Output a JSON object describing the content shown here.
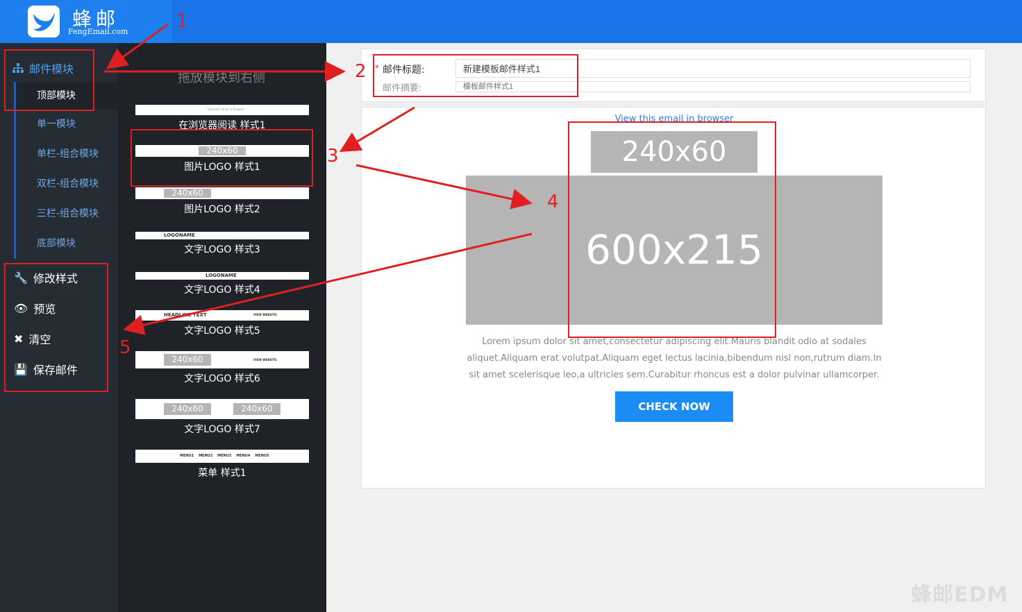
{
  "brand": {
    "name": "蜂邮",
    "domain": "FengEmail.com"
  },
  "sidebar": {
    "section_label": "邮件模块",
    "items": [
      "顶部模块",
      "单一模块",
      "单栏-组合模块",
      "双栏-组合模块",
      "三栏-组合模块",
      "底部模块"
    ],
    "actions": [
      "修改样式",
      "预览",
      "清空",
      "保存邮件"
    ]
  },
  "modules": {
    "title": "拖放模块到右侧",
    "items": [
      {
        "label": "在浏览器阅读 样式1",
        "thumb_text": "View this email in browser"
      },
      {
        "label": "图片LOGO 样式1",
        "thumb_text": "240x60"
      },
      {
        "label": "图片LOGO 样式2",
        "thumb_text": "240x60"
      },
      {
        "label": "文字LOGO 样式3",
        "thumb_text": "LOGONAME"
      },
      {
        "label": "文字LOGO 样式4",
        "thumb_text": "LOGONAME"
      },
      {
        "label": "文字LOGO 样式5",
        "thumb_text": "HEADLINE TEXT",
        "thumb_right": "VIEW WEBSITE›"
      },
      {
        "label": "文字LOGO 样式6",
        "thumb_text": "240x60",
        "thumb_right": "VIEW WEBSITE›"
      },
      {
        "label": "文字LOGO 样式7",
        "thumb_text": "240x60",
        "thumb_right": "240x60"
      },
      {
        "label": "菜单 样式1",
        "thumb_text": "MENU1    MENU2    MENU3    MENU4    MENU5"
      }
    ]
  },
  "form": {
    "required_mark": "*",
    "subject_label": "邮件标题:",
    "subject_value": "新建模板邮件样式1",
    "summary_label": "邮件摘要:",
    "summary_placeholder": "模板邮件样式1"
  },
  "preview": {
    "browser_link": "View this email in browser",
    "logo_placeholder": "240x60",
    "banner_placeholder": "600x215",
    "body_text": "Lorem ipsum dolor sit amet,consectetur adipiscing elit.Mauris blandit odio at sodales aliquet.Aliquam erat volutpat.Aliquam eget lectus lacinia,bibendum nisl non,rutrum diam.In sit amet scelerisque leo,a ultricies sem.Curabitur rhoncus est a dolor pulvinar ullamcorper.",
    "cta_label": "CHECK NOW"
  },
  "annotations": [
    "1",
    "2",
    "3",
    "4",
    "5"
  ],
  "watermark": "蜂邮EDM",
  "colors": {
    "topbar": "#1a73e8",
    "accent": "#1b8cf5",
    "annotation": "#e02020",
    "sidebar": "#252c33",
    "panel": "#1f2227"
  }
}
